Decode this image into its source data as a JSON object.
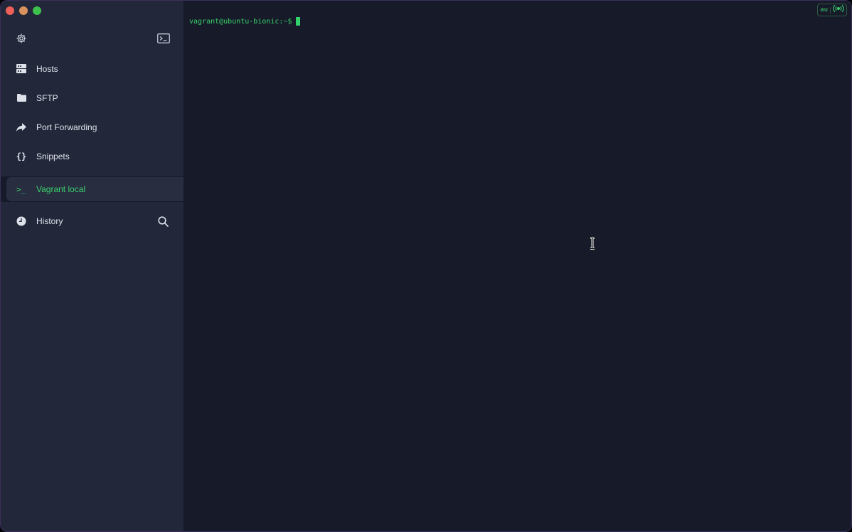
{
  "sidebar": {
    "top_icons": {
      "settings": "gear-icon",
      "terminal": "terminal-icon"
    },
    "items": [
      {
        "label": "Hosts",
        "icon": "server-icon"
      },
      {
        "label": "SFTP",
        "icon": "folder-icon"
      },
      {
        "label": "Port Forwarding",
        "icon": "port-forward-icon"
      },
      {
        "label": "Snippets",
        "icon": "braces-icon"
      }
    ],
    "active_session": {
      "label": "Vagrant local",
      "icon_glyph": ">_"
    },
    "history": {
      "label": "History",
      "icon": "clock-icon",
      "search_icon": "search-icon"
    }
  },
  "terminal": {
    "prompt": "vagrant@ubuntu-bionic:~$",
    "status": {
      "lang": "au",
      "signal_icon": "broadcast-icon"
    }
  },
  "colors": {
    "accent": "#3ad06b",
    "sidebar_bg": "#22273a",
    "terminal_bg": "#161a29"
  }
}
